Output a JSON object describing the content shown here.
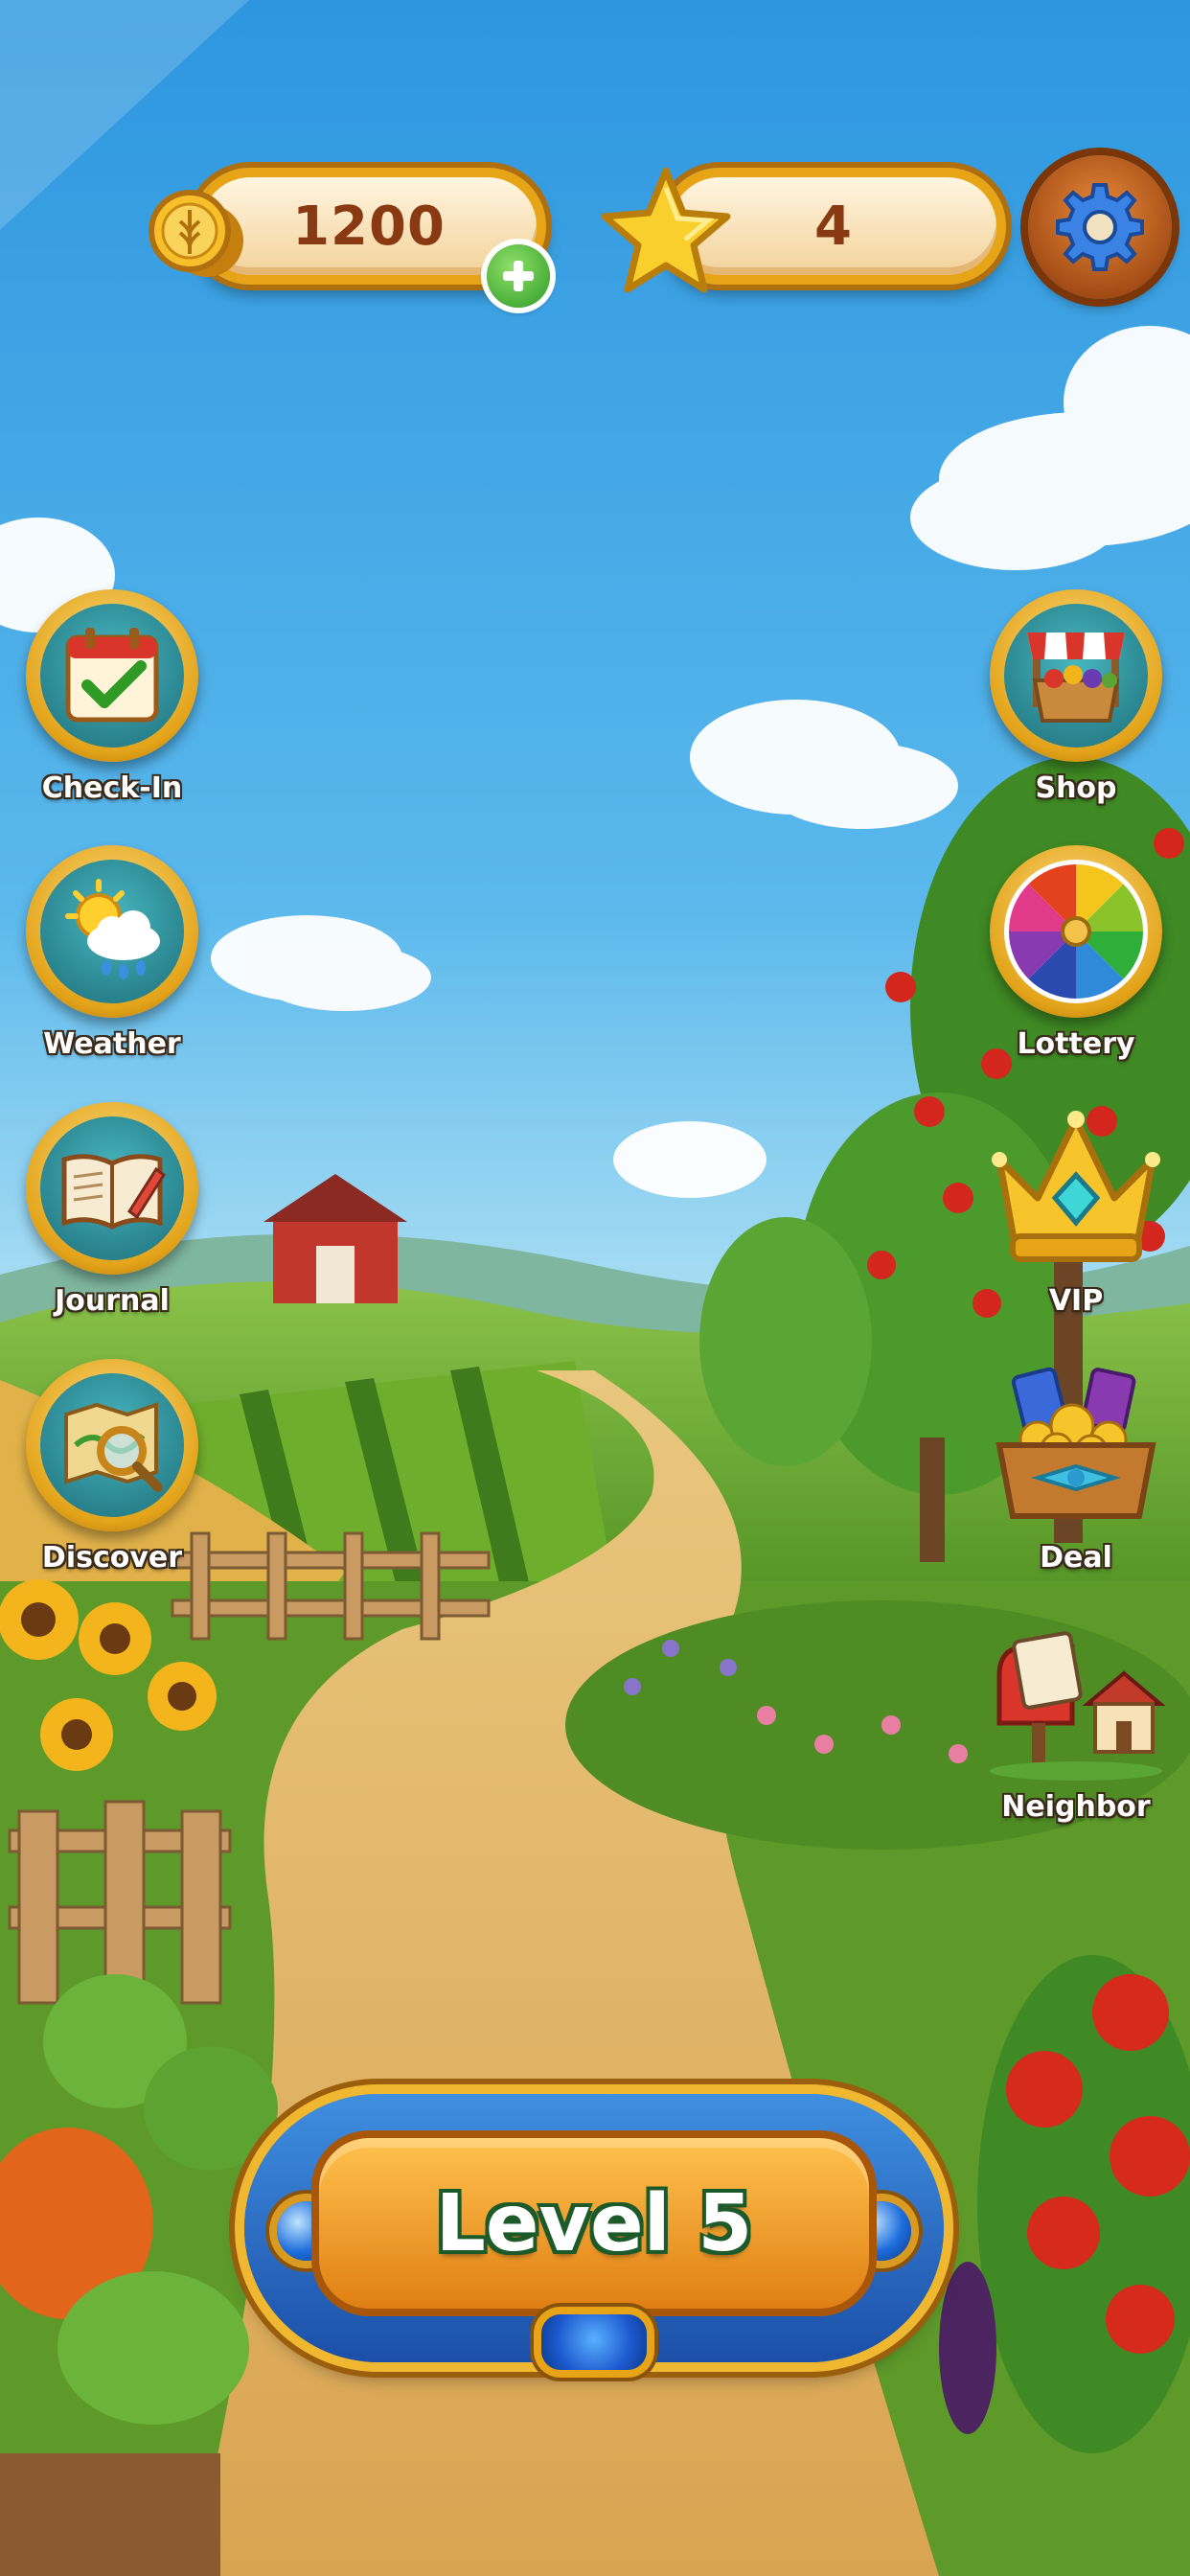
{
  "hud": {
    "coins": {
      "value": "1200",
      "icon": "coin-icon",
      "add_icon": "plus-icon"
    },
    "stars": {
      "value": "4",
      "icon": "star-icon"
    },
    "settings_icon": "gear-icon"
  },
  "left_menu": [
    {
      "label": "Check-In",
      "icon": "calendar-check-icon"
    },
    {
      "label": "Weather",
      "icon": "sun-cloud-rain-icon"
    },
    {
      "label": "Journal",
      "icon": "open-book-icon"
    },
    {
      "label": "Discover",
      "icon": "map-magnifier-icon"
    }
  ],
  "right_menu": [
    {
      "label": "Shop",
      "icon": "market-stall-icon"
    },
    {
      "label": "Lottery",
      "icon": "prize-wheel-icon"
    },
    {
      "label": "VIP",
      "icon": "crown-icon"
    },
    {
      "label": "Deal",
      "icon": "treasure-basket-icon"
    },
    {
      "label": "Neighbor",
      "icon": "mailbox-house-icon"
    }
  ],
  "play_button": {
    "label": "Level 5"
  },
  "colors": {
    "sky_top": "#2f9be0",
    "sky_bottom": "#bfe8f5",
    "gold": "#e8a417",
    "coin_text": "#8a3a12",
    "play_blue": "#1b4fa8",
    "play_orange": "#e07f14"
  }
}
